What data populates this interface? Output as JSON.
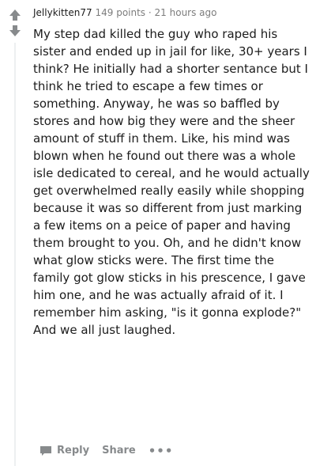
{
  "comment": {
    "author": "Jellykitten77",
    "points": "149 points",
    "separator": "·",
    "time": "21 hours ago",
    "body": "My step dad killed the guy who raped his sister and ended up in jail for like, 30+ years I think? He initially had a shorter sentance but I think he tried to escape a few times or something. Anyway, he was so baffled by stores and how big they were and the sheer amount of stuff in them. Like, his mind was blown when he found out there was a whole isle dedicated to cereal, and he would actually get overwhelmed really easily while shopping because it was so different from just marking a few items on a peice of paper and having them brought to you. Oh, and he didn't know what glow sticks were. The first time the family got glow sticks in his prescence, I gave him one, and he was actually afraid of it. I remember him asking, \"is it gonna explode?\" And we all just laughed."
  },
  "actions": {
    "reply_label": "Reply",
    "share_label": "Share",
    "more_label": "•••"
  },
  "icons": {
    "upvote": "arrow-up-icon",
    "downvote": "arrow-down-icon",
    "reply": "speech-bubble-icon",
    "more": "ellipsis-icon"
  },
  "colors": {
    "text": "#1c1c1c",
    "meta": "#7c7c7c",
    "action": "#878a8c",
    "thread_line": "#edeff1"
  }
}
